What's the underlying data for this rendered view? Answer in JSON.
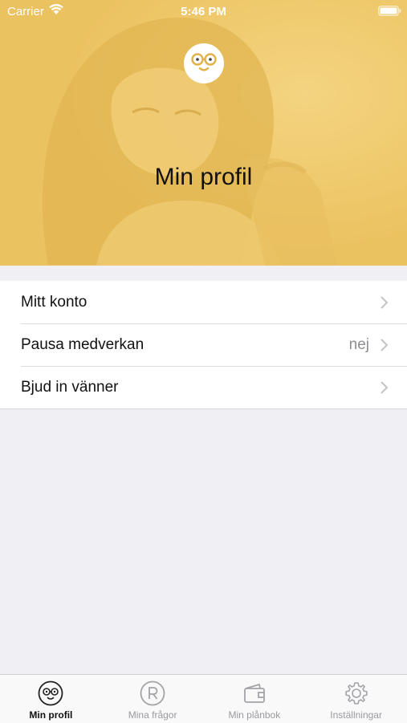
{
  "status_bar": {
    "carrier": "Carrier",
    "time": "5:46 PM"
  },
  "header": {
    "title": "Min profil",
    "tint_color": "#ecc66b"
  },
  "menu": {
    "items": [
      {
        "label": "Mitt konto",
        "value": ""
      },
      {
        "label": "Pausa medverkan",
        "value": "nej"
      },
      {
        "label": "Bjud in vänner",
        "value": ""
      }
    ]
  },
  "tab_bar": {
    "tabs": [
      {
        "label": "Min profil",
        "icon": "glasses-face-icon",
        "active": true
      },
      {
        "label": "Mina frågor",
        "icon": "registered-icon",
        "active": false
      },
      {
        "label": "Min plånbok",
        "icon": "wallet-icon",
        "active": false
      },
      {
        "label": "Inställningar",
        "icon": "gear-icon",
        "active": false
      }
    ]
  },
  "colors": {
    "accent": "#ecc66b",
    "background": "#efeff4",
    "secondary_text": "#8e8e93"
  }
}
